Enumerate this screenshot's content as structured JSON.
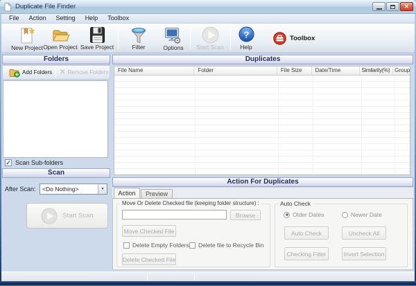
{
  "window": {
    "title": "Duplicate File Finder"
  },
  "menu": {
    "items": [
      "File",
      "Action",
      "Setting",
      "Help",
      "Toolbox"
    ]
  },
  "toolbar": {
    "buttons": [
      {
        "label": "New Project",
        "icon": "new-project-icon",
        "enabled": true
      },
      {
        "label": "Open Project",
        "icon": "open-project-icon",
        "enabled": true
      },
      {
        "label": "Save Project",
        "icon": "save-project-icon",
        "enabled": true
      },
      {
        "label": "Filter",
        "icon": "filter-icon",
        "enabled": true
      },
      {
        "label": "Options",
        "icon": "options-icon",
        "enabled": true
      },
      {
        "label": "Start Scan",
        "icon": "start-scan-icon",
        "enabled": false
      },
      {
        "label": "Help",
        "icon": "help-icon",
        "enabled": true
      },
      {
        "label": "Toolbox",
        "icon": "toolbox-icon",
        "enabled": true
      }
    ]
  },
  "folders_panel": {
    "header": "Folders",
    "add_button": "Add Folders",
    "remove_button": "Remove Folders",
    "scan_subfolders": {
      "label": "Scan Sub-folders",
      "checked": true
    }
  },
  "scan_panel": {
    "header": "Scan",
    "after_scan_label": "After Scan:",
    "after_scan_value": "<Do Nothing>",
    "start_scan_button": "Start Scan"
  },
  "duplicates_panel": {
    "header": "Duplicates",
    "columns": [
      "File Name",
      "Folder",
      "File Size",
      "Date/Time",
      "Similarity(%)",
      "Group"
    ],
    "rows": []
  },
  "action_panel": {
    "header": "Action For Duplicates",
    "tabs": [
      {
        "label": "Action",
        "active": true
      },
      {
        "label": "Preview",
        "active": false
      }
    ],
    "move_group": {
      "legend": "Move Or Delete Checked file (keeping folder structure) :",
      "path_value": "",
      "browse_button": "Browse",
      "move_button": "Move Checked File",
      "delete_empty_checkbox": {
        "label": "Delete Empty Folders",
        "checked": false
      },
      "recycle_checkbox": {
        "label": "Delete file to Recycle Bin",
        "checked": false
      },
      "delete_button": "Delete Checked File"
    },
    "auto_check_group": {
      "legend": "Auto Check",
      "older_radio": {
        "label": "Older Dates",
        "selected": true
      },
      "newer_radio": {
        "label": "Newer Date",
        "selected": false
      },
      "buttons": [
        "Auto Check",
        "Uncheck All",
        "Checking Filter",
        "Invert Selection"
      ]
    }
  },
  "statusbar": {
    "sections": [
      "",
      "",
      ""
    ]
  },
  "colors": {
    "frame_dark": "#16305c",
    "titlebar_blue": "#b9cfe2",
    "panel_bg": "#cddaec",
    "header_text": "#1c2b5a",
    "close_red": "#c6402a",
    "help_blue": "#1a50b0",
    "toolbox_red": "#cf3b28",
    "folder_yellow": "#f0c050",
    "add_green": "#52b043"
  }
}
